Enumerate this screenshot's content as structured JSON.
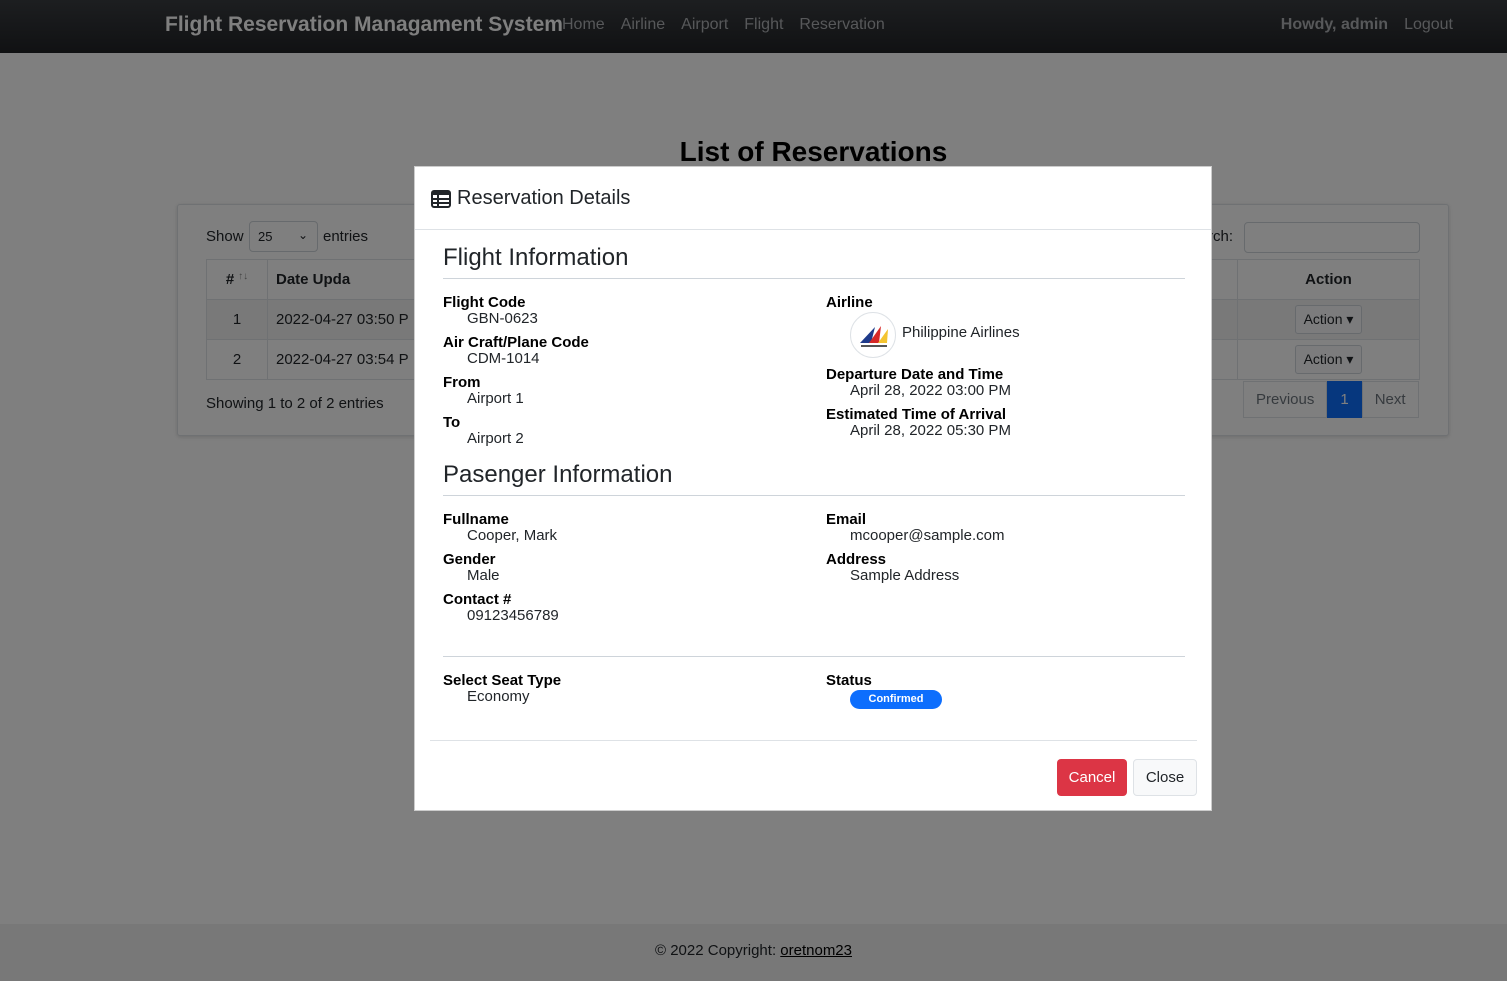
{
  "navbar": {
    "brand": "Flight Reservation Managament System",
    "links": [
      "Home",
      "Airline",
      "Airport",
      "Flight",
      "Reservation"
    ],
    "greeting": "Howdy, admin",
    "logout": "Logout"
  },
  "page": {
    "title": "List of Reservations",
    "show_label": "Show",
    "length_value": "25",
    "entries_label": "entries",
    "search_label": "rch:",
    "search_value": "",
    "columns": [
      "#",
      "Date Upda",
      "Action"
    ],
    "rows": [
      {
        "num": "1",
        "date": "2022-04-27 03:50 P",
        "action": "Action"
      },
      {
        "num": "2",
        "date": "2022-04-27 03:54 P",
        "action": "Action"
      }
    ],
    "showing": "Showing 1 to 2 of 2 entries",
    "pager": {
      "previous": "Previous",
      "current": "1",
      "next": "Next"
    }
  },
  "footer": {
    "copyright": "© 2022 Copyright:",
    "author": "oretnom23"
  },
  "modal": {
    "title": "Reservation Details",
    "flight_section": "Flight Information",
    "flight": {
      "flight_code_label": "Flight Code",
      "flight_code": "GBN-0623",
      "aircraft_label": "Air Craft/Plane Code",
      "aircraft": "CDM-1014",
      "from_label": "From",
      "from": "Airport 1",
      "to_label": "To",
      "to": "Airport 2",
      "airline_label": "Airline",
      "airline": "Philippine Airlines",
      "departure_label": "Departure Date and Time",
      "departure": "April 28, 2022 03:00 PM",
      "arrival_label": "Estimated Time of Arrival",
      "arrival": "April 28, 2022 05:30 PM"
    },
    "passenger_section": "Pasenger Information",
    "passenger": {
      "fullname_label": "Fullname",
      "fullname": "Cooper, Mark",
      "gender_label": "Gender",
      "gender": "Male",
      "contact_label": "Contact #",
      "contact": "09123456789",
      "email_label": "Email",
      "email": "mcooper@sample.com",
      "address_label": "Address",
      "address": "Sample Address"
    },
    "seat_label": "Select Seat Type",
    "seat": "Economy",
    "status_label": "Status",
    "status": "Confirmed",
    "cancel_label": "Cancel",
    "close_label": "Close"
  },
  "colors": {
    "primary": "#0d6efd",
    "danger": "#dc3545",
    "navbar": "#212326"
  }
}
